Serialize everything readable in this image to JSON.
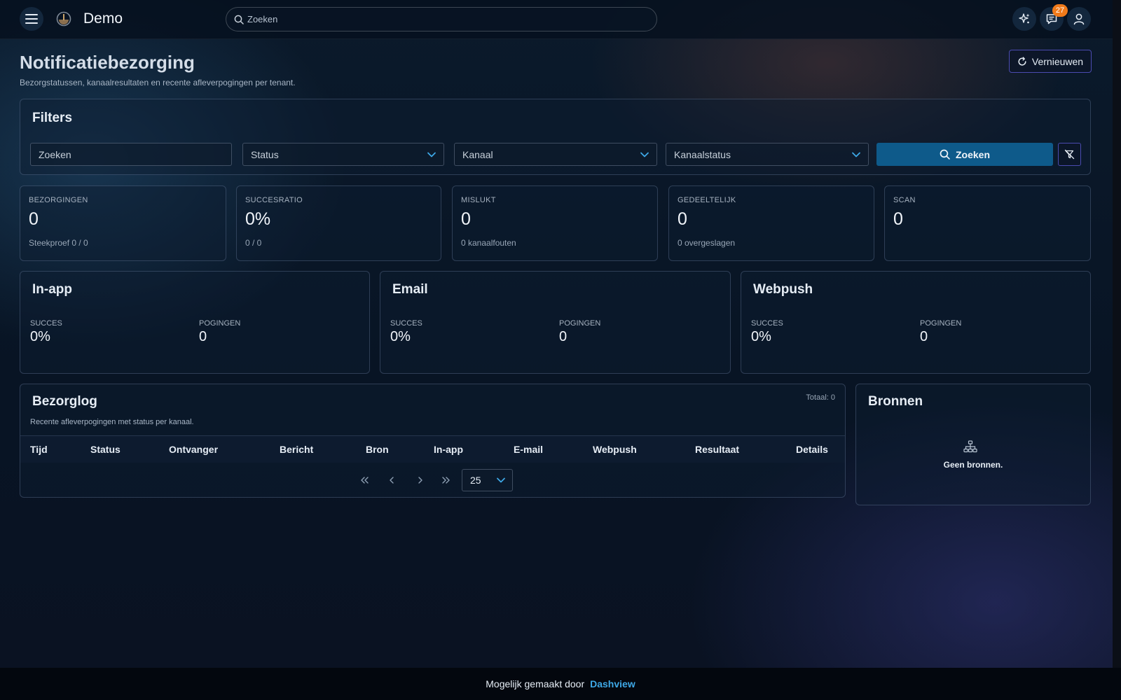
{
  "app": {
    "title": "Demo"
  },
  "topbar": {
    "search_placeholder": "Zoeken",
    "notifications_count": "27"
  },
  "page": {
    "title": "Notificatiebezorging",
    "subtitle": "Bezorgstatussen, kanaalresultaten en recente afleverpogingen per tenant.",
    "refresh_label": "Vernieuwen"
  },
  "filters": {
    "title": "Filters",
    "search_placeholder": "Zoeken",
    "status_label": "Status",
    "channel_label": "Kanaal",
    "channel_status_label": "Kanaalstatus",
    "search_button": "Zoeken"
  },
  "stats": [
    {
      "label": "BEZORGINGEN",
      "value": "0",
      "note": "Steekproef 0 / 0"
    },
    {
      "label": "SUCCESRATIO",
      "value": "0%",
      "note": "0 / 0"
    },
    {
      "label": "MISLUKT",
      "value": "0",
      "note": "0 kanaalfouten"
    },
    {
      "label": "GEDEELTELIJK",
      "value": "0",
      "note": "0 overgeslagen"
    },
    {
      "label": "SCAN",
      "value": "0",
      "note": ""
    }
  ],
  "channels": [
    {
      "name": "In-app",
      "success_label": "SUCCES",
      "success_value": "0%",
      "attempts_label": "POGINGEN",
      "attempts_value": "0"
    },
    {
      "name": "Email",
      "success_label": "SUCCES",
      "success_value": "0%",
      "attempts_label": "POGINGEN",
      "attempts_value": "0"
    },
    {
      "name": "Webpush",
      "success_label": "SUCCES",
      "success_value": "0%",
      "attempts_label": "POGINGEN",
      "attempts_value": "0"
    }
  ],
  "log": {
    "title": "Bezorglog",
    "subtitle": "Recente afleverpogingen met status per kanaal.",
    "total": "Totaal: 0",
    "columns": [
      "Tijd",
      "Status",
      "Ontvanger",
      "Bericht",
      "Bron",
      "In-app",
      "E-mail",
      "Webpush",
      "Resultaat",
      "Details"
    ],
    "page_size": "25"
  },
  "sources": {
    "title": "Bronnen",
    "empty_text": "Geen bronnen."
  },
  "footer": {
    "text": "Mogelijk gemaakt door",
    "link": "Dashview"
  },
  "icons": {
    "menu": "menu-icon",
    "logo": "logo-icon",
    "search": "search-icon",
    "assistant": "sparkles-icon",
    "chat": "chat-icon",
    "user": "user-icon",
    "refresh": "refresh-icon",
    "chevron": "chevron-down-icon",
    "filter_clear": "filter-clear-icon",
    "sources_empty": "sitemap-icon"
  },
  "colors": {
    "accent": "#0e5a8a",
    "link": "#3ea8e6",
    "badge": "#f07a1a",
    "outline": "#4b4bb0"
  }
}
